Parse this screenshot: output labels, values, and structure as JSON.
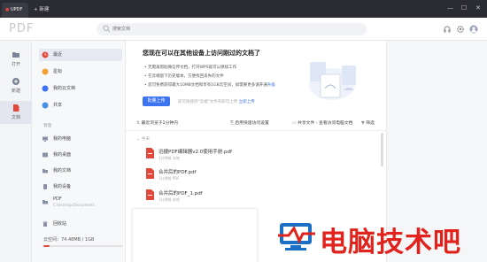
{
  "titlebar": {
    "app_tab": "UPDF",
    "new_tab": "+ 新建",
    "minimize": "—",
    "maximize": "☐",
    "close": "✕"
  },
  "header": {
    "brand": "PDF",
    "search_placeholder": "搜索文档"
  },
  "leftnav": [
    {
      "label": "打开",
      "icon": "folder-open-icon"
    },
    {
      "label": "新建",
      "icon": "new-doc-icon"
    },
    {
      "label": "文档",
      "icon": "document-icon",
      "active": true
    }
  ],
  "sidebar": {
    "items": [
      {
        "label": "最近",
        "icon": "clock-icon",
        "selected": true
      },
      {
        "label": "星标",
        "icon": "star-icon"
      },
      {
        "label": "我的云文档",
        "icon": "cloud-icon"
      },
      {
        "label": "共享",
        "icon": "share-icon"
      }
    ],
    "section_title": "管理",
    "locations": [
      {
        "label": "我的电脑",
        "icon": "computer-icon"
      },
      {
        "label": "我的桌面",
        "icon": "desktop-icon"
      },
      {
        "label": "我的文档",
        "icon": "folder-icon"
      },
      {
        "label": "我的设备",
        "icon": "device-icon"
      },
      {
        "label": "PDF",
        "sub": "C:\\Users\\pc\\Documents",
        "icon": "folder-icon"
      },
      {
        "label": "回收站",
        "icon": "trash-icon"
      }
    ],
    "storage_label": "云空间：74.48MB / 1GB",
    "storage_fraction": 0.073
  },
  "banner": {
    "title": "您现在可以在其他设备上访问刚过的文档了",
    "bullets": [
      "无需再借助微信传文档，打开WPS就可以继续工作",
      "在云端留下历史版本，方便找回丢失的文件",
      "您可免费获得最大10MB文档和享有1GB云空间，如需要更多请开通"
    ],
    "bullet_link": "升级",
    "upload_button": "批量上传",
    "upload_hint": "即可拖拽到\"云端\"文件夹即可上传",
    "upload_hint_link": "立即上传"
  },
  "toolbar": {
    "sort": "最近浏览于1分钟内",
    "cloud_sync": "启用快速访问设置",
    "share": "共享文件 - 查看访问电脑文档",
    "filter": "筛选"
  },
  "files": {
    "group": "今天",
    "items": [
      {
        "name": "迅捷PDF编辑器v2.0使用手册.pdf",
        "meta": "1分钟前   本地"
      },
      {
        "name": "合并后的PDF.pdf",
        "meta": "1分钟前   PDF"
      },
      {
        "name": "合并后的PDF_1.pdf",
        "meta": "1分钟前   本地"
      }
    ]
  },
  "watermark": {
    "text": "电脑技术吧"
  }
}
